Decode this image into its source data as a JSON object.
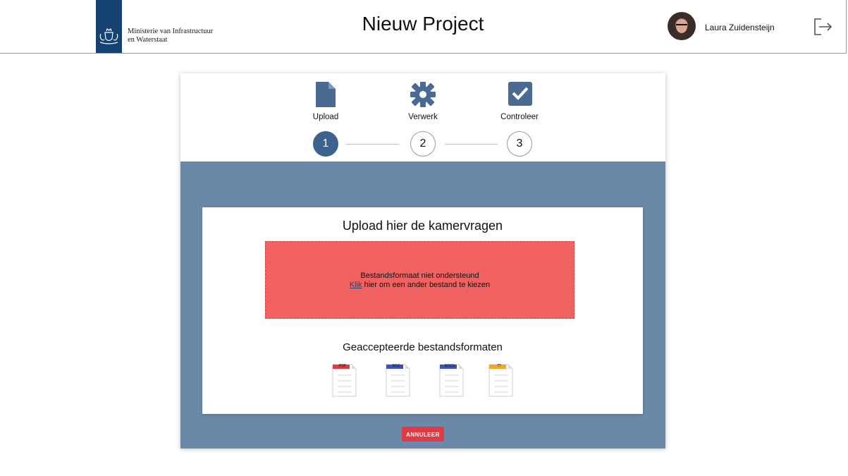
{
  "header": {
    "ministry_line1": "Ministerie van Infrastructuur",
    "ministry_line2": "en Waterstaat",
    "title": "Nieuw Project",
    "user_name": "Laura Zuidensteijn",
    "logout_icon": "logout-icon",
    "brand_color": "#154273"
  },
  "stepper": {
    "steps": [
      {
        "label": "Upload",
        "number": "1",
        "icon": "file-icon",
        "active": true
      },
      {
        "label": "Verwerk",
        "number": "2",
        "icon": "gear-icon",
        "active": false
      },
      {
        "label": "Controleer",
        "number": "3",
        "icon": "checkbox-icon",
        "active": false
      }
    ],
    "accent_color": "#3d628d"
  },
  "upload": {
    "title": "Upload hier de kamervragen",
    "error_line1": "Bestandsformaat niet ondersteund",
    "link_text": "Klik",
    "error_line2_rest": " hier om een ander bestand te kiezen",
    "error_color": "#ef6261",
    "accepted_title": "Geaccepteerde bestandsformaten",
    "formats": [
      {
        "label": "PDF",
        "color": "#e03a45"
      },
      {
        "label": "DOC",
        "color": "#3f51b5"
      },
      {
        "label": "DOCX",
        "color": "#3f51b5"
      },
      {
        "label": "??",
        "color": "#f5a623"
      }
    ]
  },
  "actions": {
    "cancel_label": "ANNULEER",
    "cancel_color": "#e03a45"
  },
  "panel_color": "#6a89a9"
}
